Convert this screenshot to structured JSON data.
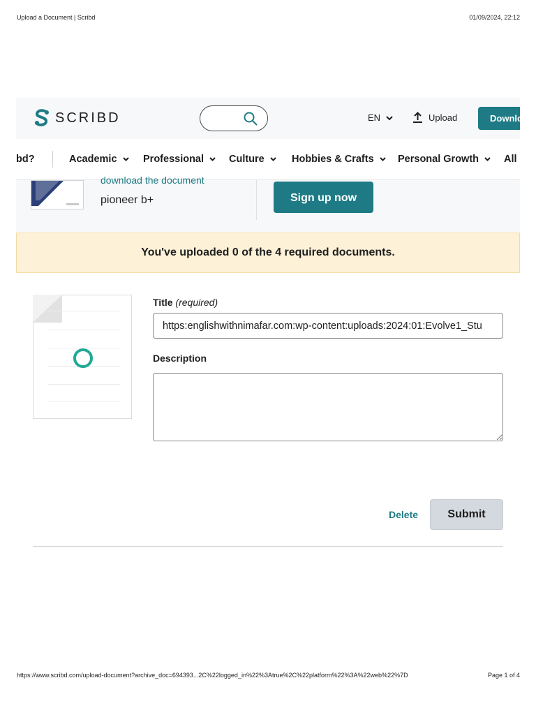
{
  "print_header": {
    "title": "Upload a Document | Scribd",
    "datetime": "01/09/2024, 22:12"
  },
  "print_footer": {
    "url": "https://www.scribd.com/upload-document?archive_doc=694393...2C%22logged_in%22%3Atrue%2C%22platform%22%3A%22web%22%7D",
    "page": "Page 1 of 4"
  },
  "header": {
    "logo_text": "SCRIBD",
    "lang": "EN",
    "upload_label": "Upload",
    "download_label": "Download"
  },
  "categories": [
    {
      "label": "ibd?"
    },
    {
      "label": "Academic"
    },
    {
      "label": "Professional"
    },
    {
      "label": "Culture"
    },
    {
      "label": "Hobbies & Crafts"
    },
    {
      "label": "Personal Growth"
    },
    {
      "label": "All D"
    }
  ],
  "promo": {
    "line1": "download the document",
    "doc_title": "pioneer b+",
    "signup_label": "Sign up now"
  },
  "notice": "You've uploaded 0 of the 4 required documents.",
  "form": {
    "title_label": "Title",
    "title_required": "(required)",
    "title_value": "https:englishwithnimafar.com:wp-content:uploads:2024:01:Evolve1_Stu",
    "description_label": "Description",
    "description_value": "",
    "delete_label": "Delete",
    "submit_label": "Submit"
  },
  "colors": {
    "brand_teal": "#1e7b85",
    "notice_bg": "#fdf1d8",
    "spinner": "#22a996"
  }
}
